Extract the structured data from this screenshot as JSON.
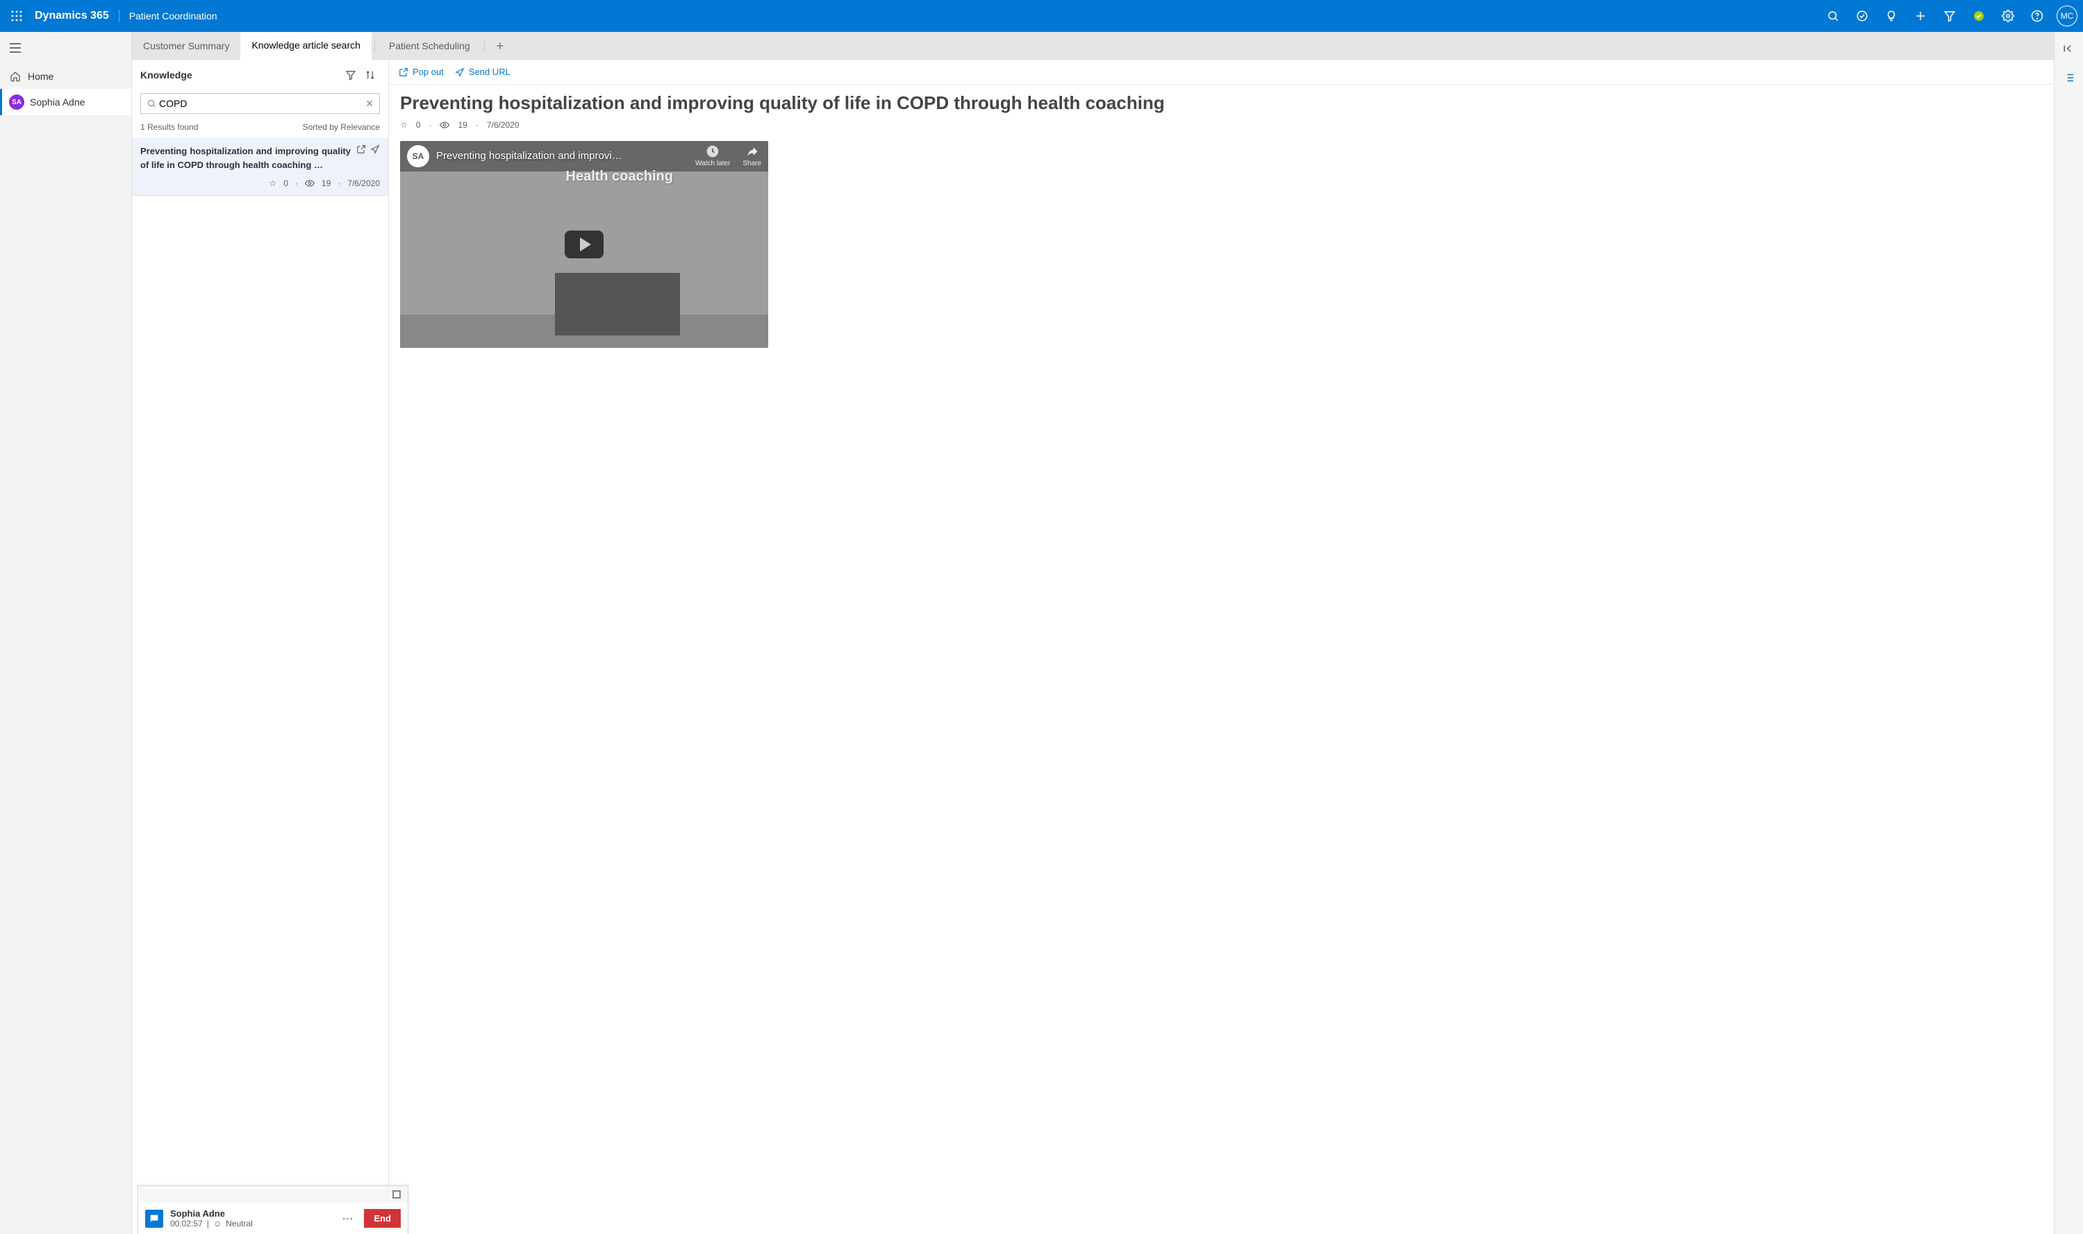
{
  "header": {
    "app_title": "Dynamics 365",
    "app_subtitle": "Patient Coordination",
    "user_initials": "MC"
  },
  "sidebar": {
    "home_label": "Home",
    "session": {
      "initials": "SA",
      "name": "Sophia Adne"
    }
  },
  "tabs": {
    "customer_summary": "Customer Summary",
    "knowledge_search": "Knowledge article search",
    "patient_scheduling": "Patient Scheduling"
  },
  "knowledge": {
    "panel_title": "Knowledge",
    "search_value": "COPD",
    "results_found": "1 Results found",
    "sorted_by": "Sorted by Relevance",
    "result": {
      "title": "Preventing hospitalization and improving quality of life in COPD through health coaching …",
      "rating": "0",
      "views": "19",
      "date": "7/6/2020"
    }
  },
  "article": {
    "toolbar": {
      "popout": "Pop out",
      "sendurl": "Send URL"
    },
    "title": "Preventing hospitalization and improving quality of life in COPD through health coaching",
    "rating": "0",
    "views": "19",
    "date": "7/6/2020",
    "video": {
      "avatar_initials": "SA",
      "title": "Preventing hospitalization and improvi…",
      "watch_later": "Watch later",
      "share": "Share",
      "scene_text": "Health coaching"
    }
  },
  "session_widget": {
    "name": "Sophia Adne",
    "timer": "00:02:57",
    "sentiment": "Neutral",
    "end_label": "End"
  }
}
